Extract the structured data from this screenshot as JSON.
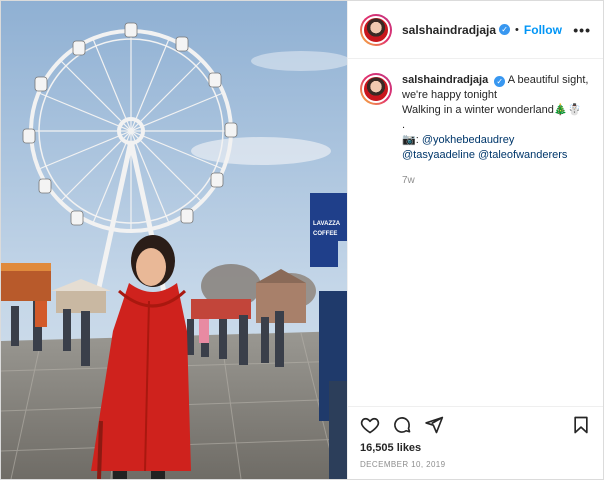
{
  "post": {
    "username": "salshaindradjaja",
    "verified_glyph": "✓",
    "follow_label": "Follow",
    "separator": "•",
    "more_label": "•••",
    "caption": {
      "line1": "A beautiful sight,",
      "line2": "we're happy tonight",
      "line3": "Walking in a winter wonderland🎄☃️",
      "line4": ".",
      "camera_glyph": "📷",
      "mention1": "@yokhebedaudrey",
      "mention2": "@tasyaadeline",
      "mention3": "@taleofwanderers"
    },
    "time_ago": "7w",
    "likes": "16,505 likes",
    "date": "DECEMBER 10, 2019"
  },
  "photo": {
    "banner_line1": "LAVAZZA",
    "banner_line2": "COFFEE",
    "icon": "photo-icon"
  },
  "colors": {
    "accent": "#0095f6",
    "verified": "#3897f0",
    "coat": "#d2221e",
    "sky": "#b9cde3"
  }
}
